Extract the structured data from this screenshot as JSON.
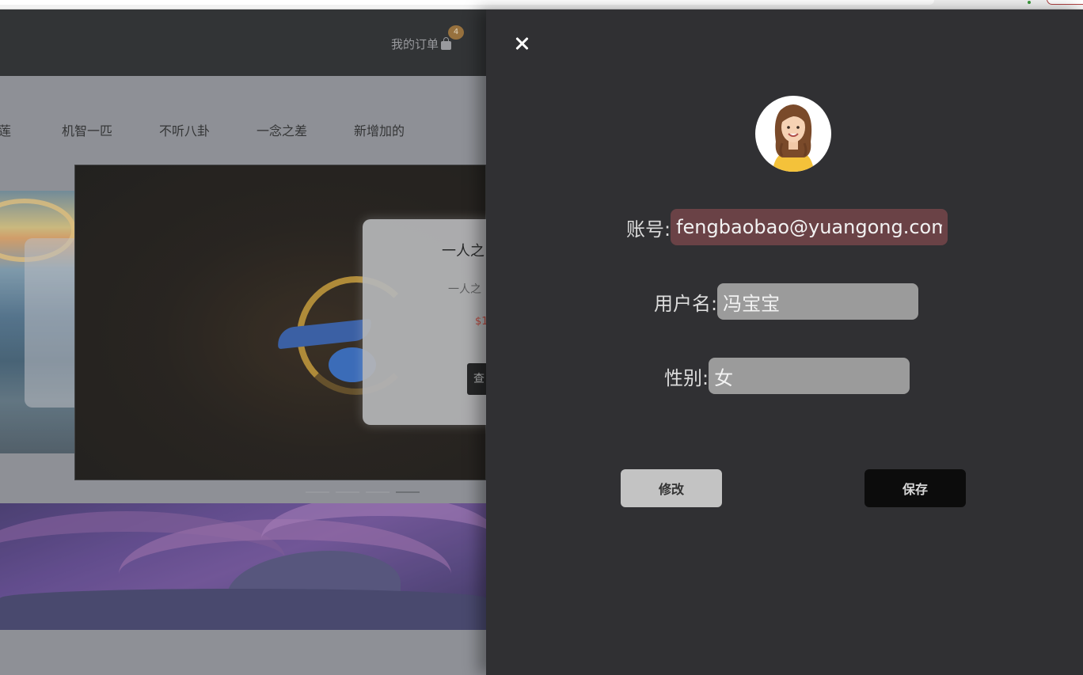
{
  "header": {
    "orders_label": "我的订单",
    "orders_badge": "4"
  },
  "nav": {
    "items": [
      "莲",
      "机智一匹",
      "不听八卦",
      "一念之差",
      "新增加的"
    ]
  },
  "carousel": {
    "card_title": "一人之",
    "card_desc": "一人之",
    "card_price": "$1",
    "card_button": "查"
  },
  "profile": {
    "account_label": "账号:",
    "account_value": "fengbaobao@yuangong.com",
    "username_label": "用户名:",
    "username_value": "冯宝宝",
    "gender_label": "性别:",
    "gender_value": "女",
    "edit_button": "修改",
    "save_button": "保存"
  },
  "colors": {
    "drawer_bg": "#303033",
    "account_field_bg": "#6a4246",
    "field_bg": "#9b9b9b",
    "edit_button_bg": "#c3c3c3",
    "save_button_bg": "#0c0c0c",
    "header_bg": "#1f2022",
    "badge_bg": "#9a6b2b"
  },
  "icons": {
    "close": "close-icon",
    "avatar": "avatar-icon",
    "orders": "shopping-bag-icon"
  }
}
